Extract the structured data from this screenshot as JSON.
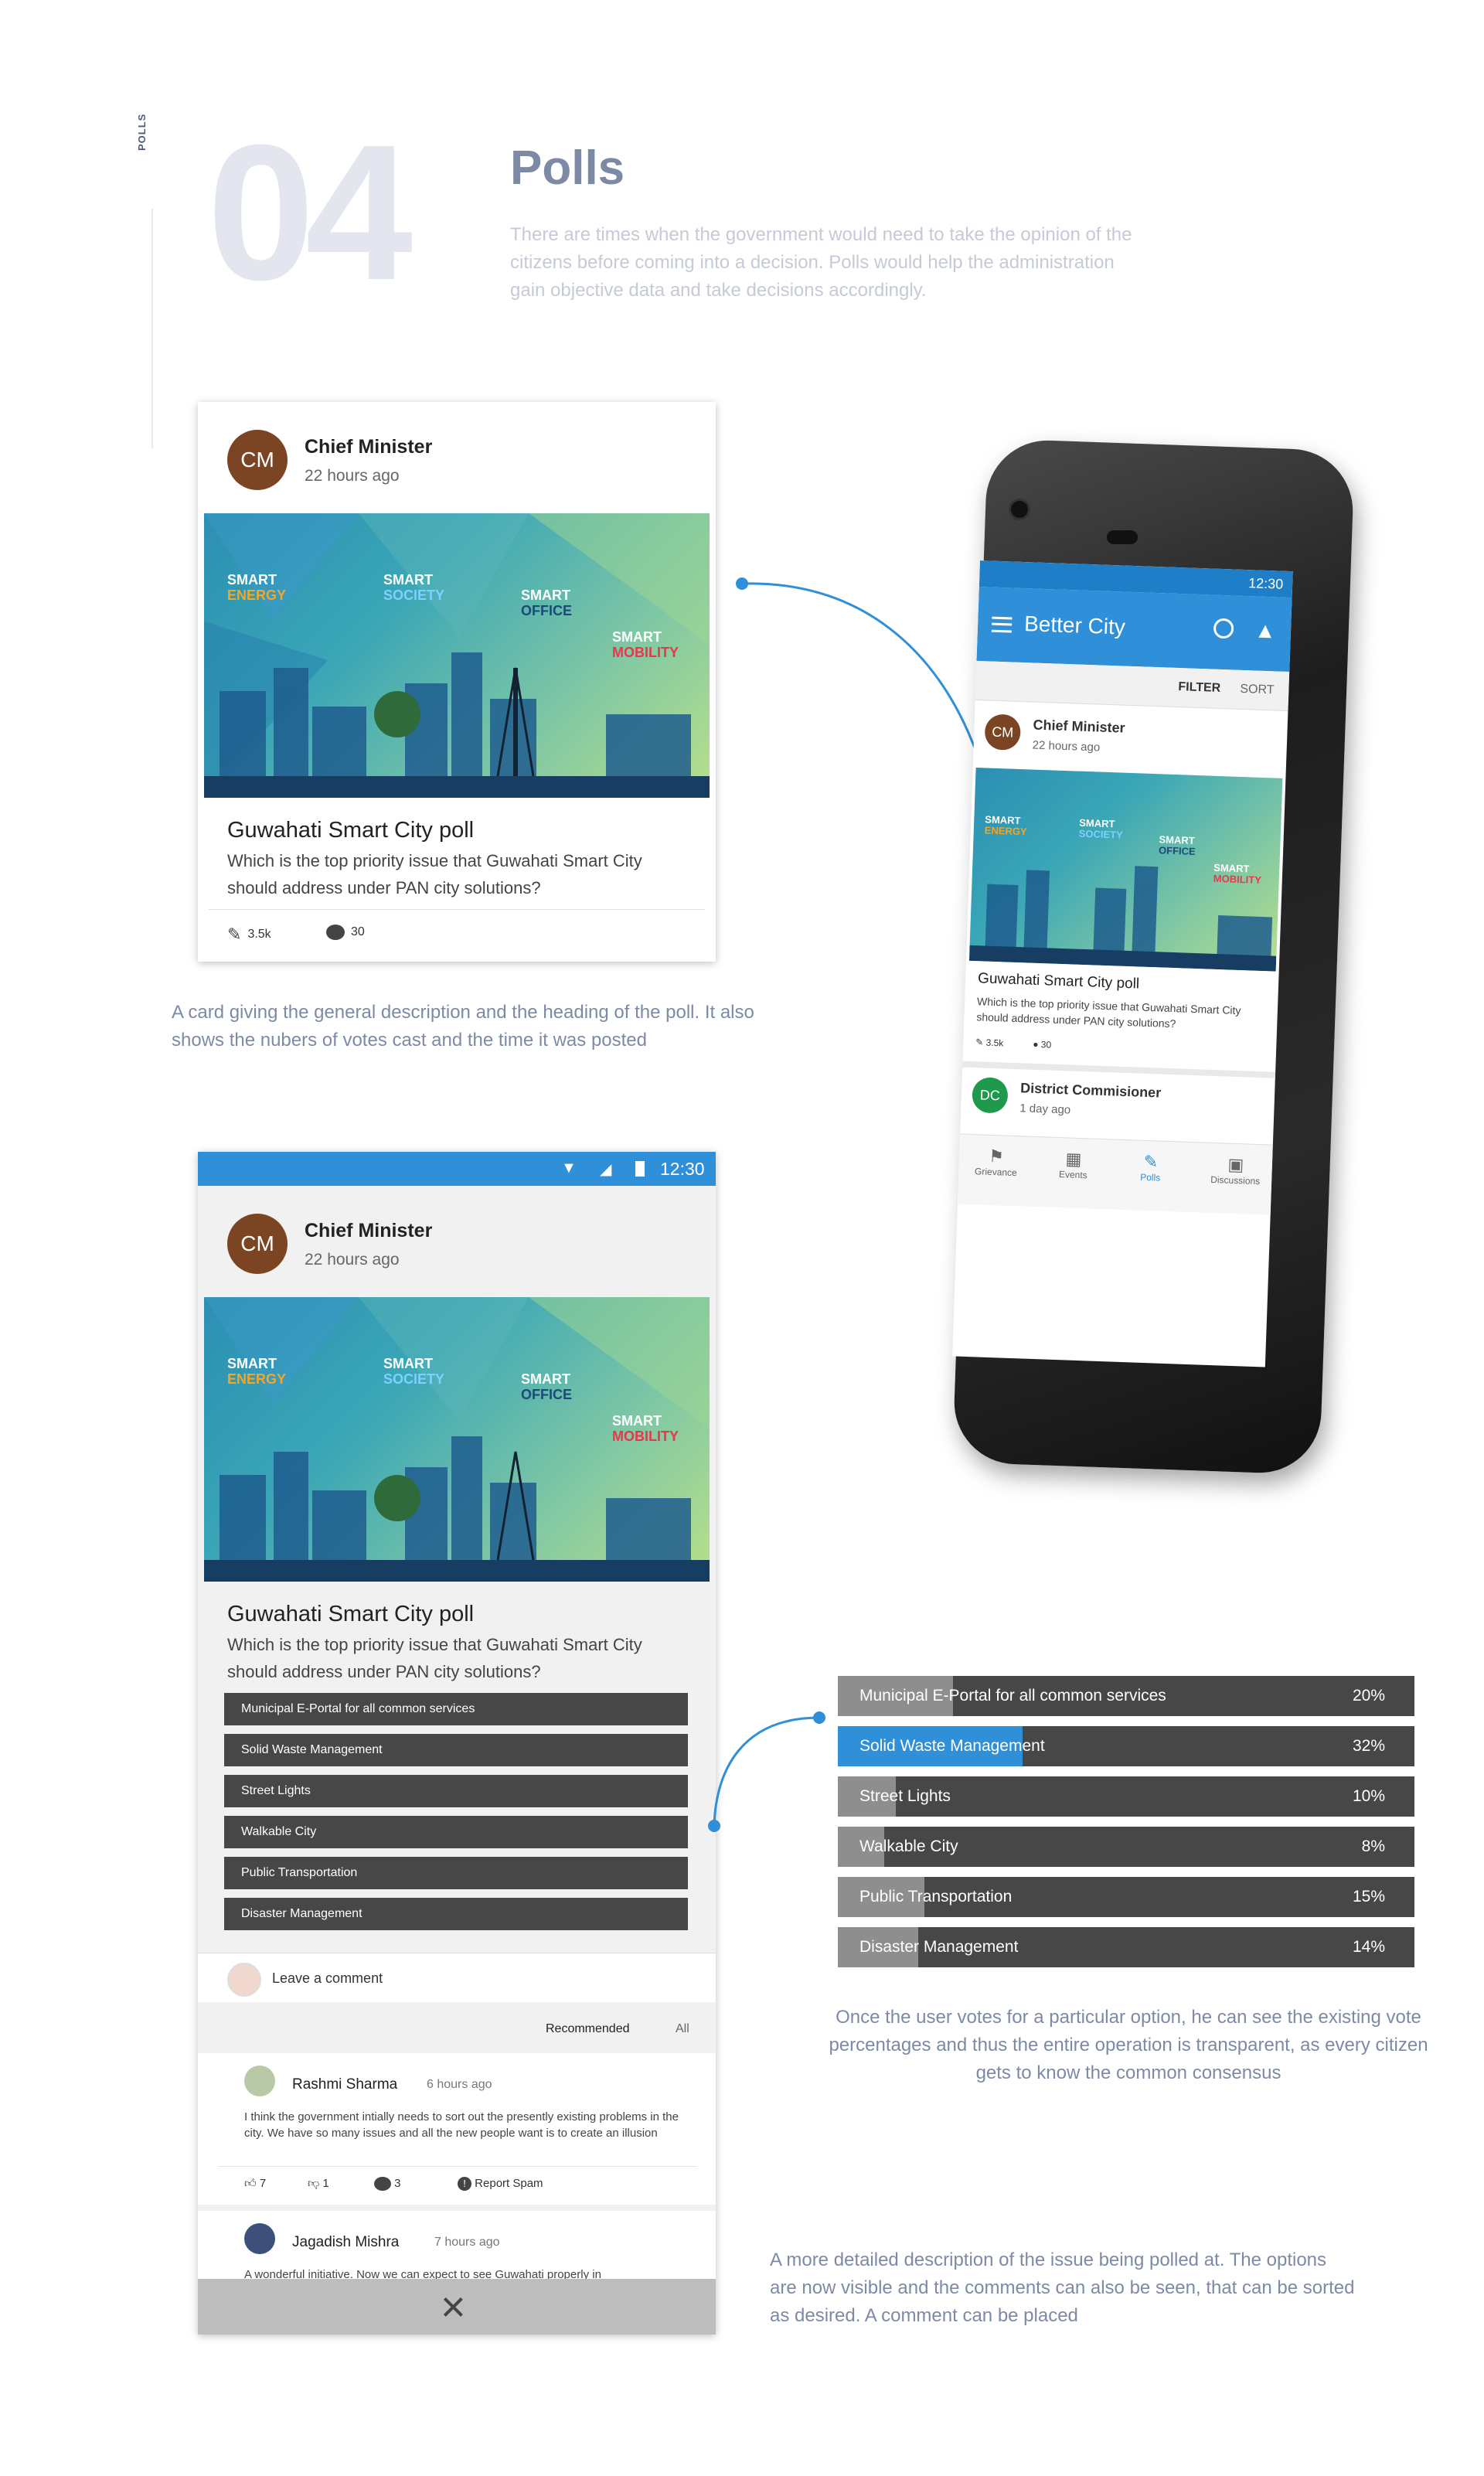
{
  "section": {
    "side_label": "POLLS",
    "number": "04",
    "title": "Polls",
    "intro": "There are times when the government would need to take the opinion of the citizens before coming into a decision. Polls would help the administration gain objective data and take decisions accordingly."
  },
  "post": {
    "avatar": "CM",
    "author": "Chief Minister",
    "time": "22 hours ago",
    "banner": {
      "energy_1": "SMART",
      "energy_2": "ENERGY",
      "society_1": "SMART",
      "society_2": "SOCIETY",
      "office_1": "SMART",
      "office_2": "OFFICE",
      "mobility_1": "SMART",
      "mobility_2": "MOBILITY"
    },
    "poll_title": "Guwahati Smart City poll",
    "poll_desc": "Which is the top priority issue that Guwahati Smart City should address under PAN city solutions?",
    "votes": "3.5k",
    "comments": "30"
  },
  "caption_card": "A card giving the general description and the heading of the poll. It also shows the nubers of votes cast and the time it was posted",
  "status_bar": {
    "time": "12:30"
  },
  "options": [
    "Municipal E-Portal for all common services",
    "Solid Waste Management",
    "Street Lights",
    "Walkable City",
    "Public Transportation",
    "Disaster Management"
  ],
  "results": [
    {
      "label": "Municipal E-Portal for all common services",
      "percent": "20%",
      "fraction": 0.2,
      "selected": false
    },
    {
      "label": "Solid Waste Management",
      "percent": "32%",
      "fraction": 0.32,
      "selected": true
    },
    {
      "label": "Street Lights",
      "percent": "10%",
      "fraction": 0.1,
      "selected": false
    },
    {
      "label": "Walkable City",
      "percent": "8%",
      "fraction": 0.08,
      "selected": false
    },
    {
      "label": "Public Transportation",
      "percent": "15%",
      "fraction": 0.15,
      "selected": false
    },
    {
      "label": "Disaster Management",
      "percent": "14%",
      "fraction": 0.14,
      "selected": false
    }
  ],
  "caption_results": "Once the user votes for a particular option, he can see the existing vote percentages and thus the entire operation is transparent, as every citizen gets to know the common consensus",
  "comment_box": {
    "placeholder": "Leave a comment"
  },
  "sort_tabs": {
    "recommended": "Recommended",
    "all": "All"
  },
  "comments": [
    {
      "author": "Rashmi Sharma",
      "time": "6 hours ago",
      "text": "I think the government intially needs to sort out the presently existing problems in the city. We have so many issues and all the new people want is to create an illusion",
      "likes": "7",
      "dislikes": "1",
      "replies": "3",
      "report": "Report Spam"
    },
    {
      "author": "Jagadish Mishra",
      "time": "7 hours ago",
      "text": "A wonderful initiative. Now we can expect to see Guwahati properly in"
    }
  ],
  "caption_detail": "A more detailed description of the issue being polled at. The options are now visible and the comments can also be seen, that can be sorted as desired. A comment can be placed",
  "app": {
    "status_time": "12:30",
    "title": "Better City",
    "filter": "FILTER",
    "sort": "SORT",
    "second_avatar": "DC",
    "second_author": "District Commisioner",
    "second_time": "1 day ago",
    "nav": [
      "Grievance",
      "Events",
      "Polls",
      "Discussions"
    ],
    "accent": "#2f8fd8"
  }
}
